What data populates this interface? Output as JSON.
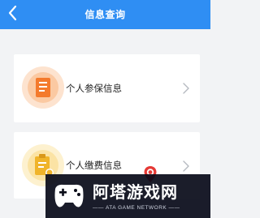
{
  "header": {
    "title": "信息查询",
    "back_icon": "chevron-left-icon"
  },
  "items": [
    {
      "label": "个人参保信息",
      "icon": "document-icon",
      "color": "#f47a2c",
      "halo": "#fde3cf"
    },
    {
      "label": "个人缴费信息",
      "icon": "clipboard-icon",
      "color": "#f0b42a",
      "halo": "#fdf1cf"
    }
  ],
  "overlay": {
    "location_icon": "location-pin-icon",
    "watermark": {
      "title": "阿塔游戏网",
      "subtitle": "—— ATA GAME NETWORK ——",
      "logo_icon": "gamepad-icon"
    }
  },
  "colors": {
    "header": "#2f8ef3",
    "background": "#f2f3f5",
    "card": "#ffffff"
  }
}
